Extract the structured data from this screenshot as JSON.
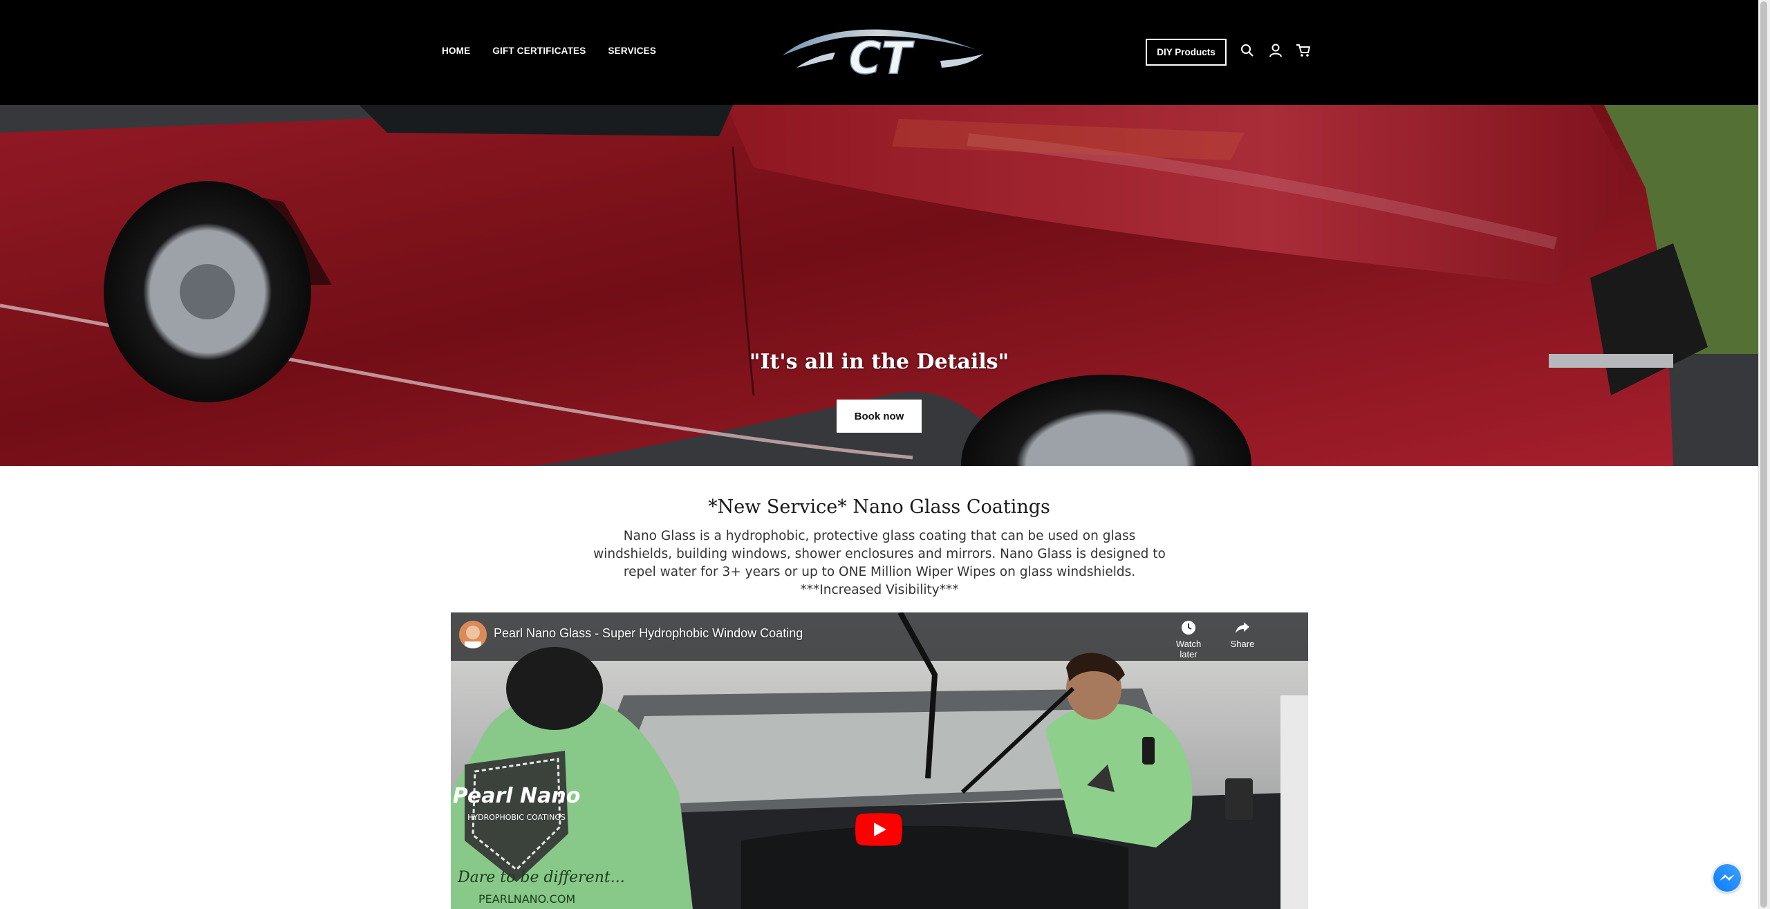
{
  "header": {
    "nav": [
      "HOME",
      "GIFT CERTIFICATES",
      "SERVICES"
    ],
    "diy_button": "DIY Products",
    "icons": [
      "search-icon",
      "account-icon",
      "cart-icon"
    ],
    "logo_text": "CT",
    "background": "#000000"
  },
  "hero": {
    "title": "\"It's all in the Details\"",
    "button": "Book now",
    "image": "red classic car",
    "color": "#8b1a22"
  },
  "section": {
    "title": "*New Service* Nano Glass Coatings",
    "body": "Nano Glass is a hydrophobic, protective glass coating that can be used on glass windshields, building windows, shower enclosures and mirrors. Nano Glass is designed to repel water for 3+ years or up to ONE Million Wiper Wipes on glass windshields.",
    "note": "***Increased Visibility***"
  },
  "video": {
    "title": "Pearl Nano Glass - Super Hydrophobic Window Coating",
    "watch_later": "Watch later",
    "share": "Share",
    "play_color": "#ff0000",
    "shirt_text_1": "Pearl Nano",
    "shirt_text_2": "HYDROPHOBIC COATINGS",
    "shirt_text_3": "Dare to be different...",
    "shirt_text_4": "PEARLNANO.COM"
  },
  "messenger": {
    "icon": "messenger-icon",
    "color": "#0a7cff"
  }
}
